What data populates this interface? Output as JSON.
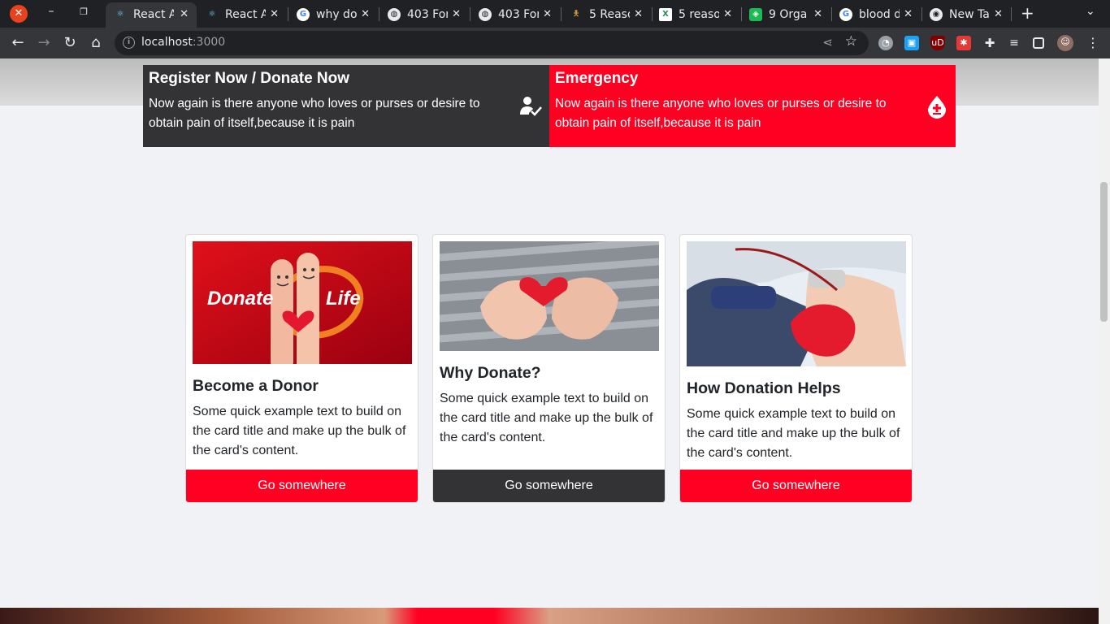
{
  "browser": {
    "tabs": [
      {
        "title": "React A",
        "icon": "react-icon",
        "active": true
      },
      {
        "title": "React A",
        "icon": "react-icon",
        "active": false
      },
      {
        "title": "why do",
        "icon": "google-icon",
        "active": false
      },
      {
        "title": "403 For",
        "icon": "globe-icon",
        "active": false
      },
      {
        "title": "403 For",
        "icon": "globe-icon",
        "active": false
      },
      {
        "title": "5 Reaso",
        "icon": "figure-icon",
        "active": false
      },
      {
        "title": "5 reaso",
        "icon": "x-logo-icon",
        "active": false
      },
      {
        "title": "9 Orga",
        "icon": "org-icon",
        "active": false
      },
      {
        "title": "blood d",
        "icon": "google-icon",
        "active": false
      },
      {
        "title": "New Ta",
        "icon": "chrome-icon",
        "active": false
      }
    ],
    "url_host": "localhost",
    "url_port": ":3000"
  },
  "top_boxes": {
    "register": {
      "title": "Register Now / Donate Now",
      "text": "Now again is there anyone who loves or purses or desire to obtain pain of itself,because it is pain",
      "icon": "user-check-icon"
    },
    "emergency": {
      "title": "Emergency",
      "text": "Now again is there anyone who loves or purses or desire to obtain pain of itself,because it is pain",
      "icon": "blood-drop-plus-icon"
    }
  },
  "cards": [
    {
      "title": "Become a Donor",
      "text": "Some quick example text to build on the card title and make up the bulk of the card's content.",
      "button": "Go somewhere",
      "image_text_left": "Donate",
      "image_text_right": "Life"
    },
    {
      "title": "Why Donate?",
      "text": "Some quick example text to build on the card title and make up the bulk of the card's content.",
      "button": "Go somewhere"
    },
    {
      "title": "How Donation Helps",
      "text": "Some quick example text to build on the card title and make up the bulk of the card's content.",
      "button": "Go somewhere"
    }
  ],
  "colors": {
    "brand_red": "#ff0022",
    "dark": "#333335",
    "page_bg": "#f0f2f5"
  }
}
